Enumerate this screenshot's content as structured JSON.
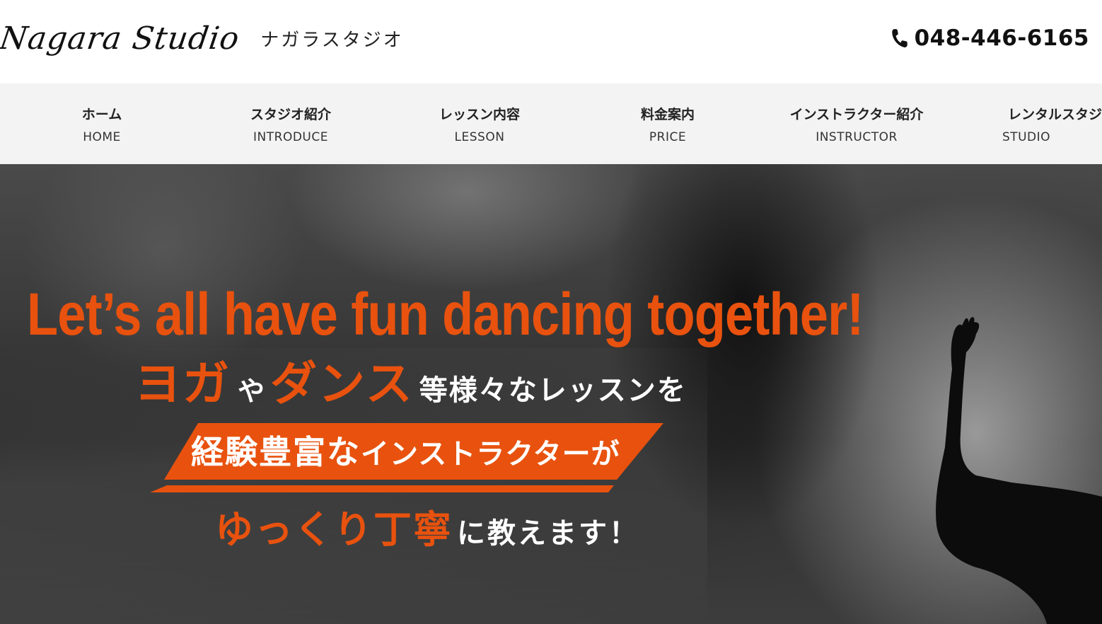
{
  "header": {
    "logo_script": "Nagara Studio",
    "logo_kana": "ナガラスタジオ",
    "phone_icon": "phone-icon",
    "phone_number": "048-446-6165"
  },
  "nav": {
    "items": [
      {
        "ja": "ホーム",
        "en": "HOME"
      },
      {
        "ja": "スタジオ紹介",
        "en": "INTRODUCE"
      },
      {
        "ja": "レッスン内容",
        "en": "LESSON"
      },
      {
        "ja": "料金案内",
        "en": "PRICE"
      },
      {
        "ja": "インストラクター紹介",
        "en": "INSTRUCTOR"
      },
      {
        "ja": "レンタルスタジオ",
        "en": "STUDIO"
      }
    ]
  },
  "hero": {
    "tagline": "Let’s all have fun dancing together!",
    "line2": {
      "yoga": "ヨガ",
      "ya": "や",
      "dance": "ダンス",
      "rest": "等様々なレッスンを"
    },
    "line3": {
      "experienced": "経験豊富な",
      "instructor": "インストラクター",
      "ga": "が"
    },
    "line4": {
      "slowly": "ゆっくり丁寧",
      "rest": "に教えます！"
    }
  },
  "colors": {
    "accent": "#e8520e",
    "nav_bg": "#f3f3f3",
    "header_bg": "#ffffff"
  }
}
